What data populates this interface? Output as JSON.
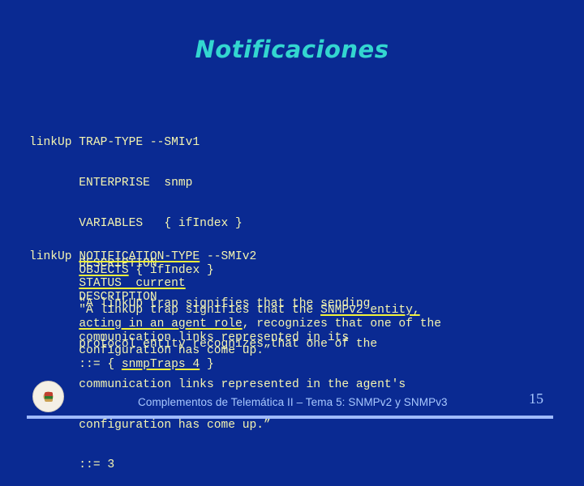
{
  "slide": {
    "title": "Notificaciones",
    "footer_text": "Complementos de Telemática II – Tema 5: SNMPv2 y SNMPv3",
    "page_number": "15",
    "logo": "university-seal-logo"
  },
  "colors": {
    "background": "#0a2a92",
    "title": "#33d6d0",
    "code_text": "#f4f4b0",
    "underline": "#f2f23a",
    "footer": "#a8c8ff",
    "rule": "#9fbaff"
  },
  "smiv1_block": {
    "lines": [
      "linkUp TRAP-TYPE --SMIv1",
      "       ENTERPRISE  snmp",
      "       VARIABLES   { ifIndex }",
      "       DESCRIPTION",
      "       \"A linkUp trap signifies that the sending",
      "       protocol entity recognizes that one of the",
      "       communication links represented in the agent's",
      "       configuration has come up.”",
      "       ::= 3"
    ]
  },
  "smiv2_block": {
    "lines": [
      [
        {
          "t": "linkUp "
        },
        {
          "t": "NOTIFICATION-TYPE",
          "u": true
        },
        {
          "t": " --SMIv2"
        }
      ],
      [
        {
          "t": "       "
        },
        {
          "t": "OBJECTS",
          "u": true
        },
        {
          "t": " { ifIndex }"
        }
      ],
      [
        {
          "t": "       "
        },
        {
          "t": "STATUS  current",
          "u": true
        }
      ],
      [
        {
          "t": "       DESCRIPTION"
        }
      ],
      [
        {
          "t": "       \"A linkUp trap signifies that the "
        },
        {
          "t": "SNMPv2 entity,",
          "u": true
        }
      ],
      [
        {
          "t": "       "
        },
        {
          "t": "acting in an agent role",
          "u": true
        },
        {
          "t": ", recognizes that one of the"
        }
      ],
      [
        {
          "t": "       communication links represented in its"
        }
      ],
      [
        {
          "t": "       configuration has come up.”"
        }
      ],
      [
        {
          "t": "       ::= { "
        },
        {
          "t": "snmpTraps 4",
          "u": true
        },
        {
          "t": " }"
        }
      ]
    ]
  }
}
